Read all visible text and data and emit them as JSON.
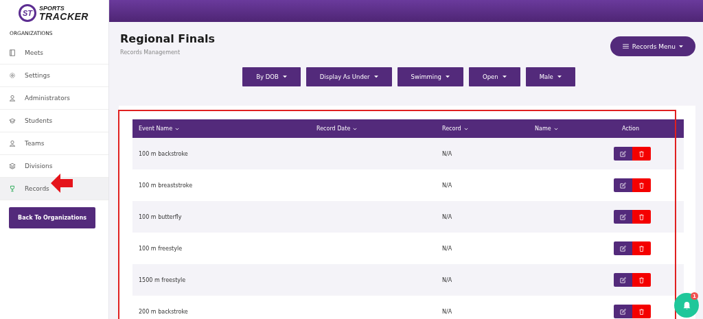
{
  "brand": {
    "mark": "ST",
    "line1": "SPORTS",
    "line2": "TRACKER"
  },
  "sidebar": {
    "heading": "ORGANIZATIONS",
    "items": [
      {
        "label": "Meets",
        "kind": "book",
        "selected": false
      },
      {
        "label": "Settings",
        "kind": "gear",
        "selected": false
      },
      {
        "label": "Administrators",
        "kind": "person",
        "selected": false
      },
      {
        "label": "Students",
        "kind": "cap",
        "selected": false
      },
      {
        "label": "Teams",
        "kind": "person",
        "selected": false
      },
      {
        "label": "Divisions",
        "kind": "layers",
        "selected": false
      },
      {
        "label": "Records",
        "kind": "trophy",
        "selected": true
      }
    ],
    "back_button": "Back To Organizations"
  },
  "header": {
    "title": "Regional Finals",
    "subtitle": "Records Management",
    "menu_button": "Records Menu"
  },
  "filters": [
    "By DOB",
    "Display As Under",
    "Swimming",
    "Open",
    "Male"
  ],
  "table": {
    "columns": [
      "Event Name",
      "Record Date",
      "Record",
      "Name",
      "Action"
    ],
    "rows": [
      {
        "event": "100 m backstroke",
        "record": "N/A"
      },
      {
        "event": "100 m breaststroke",
        "record": "N/A"
      },
      {
        "event": "100 m butterfly",
        "record": "N/A"
      },
      {
        "event": "100 m freestyle",
        "record": "N/A"
      },
      {
        "event": "1500 m freestyle",
        "record": "N/A"
      },
      {
        "event": "200 m backstroke",
        "record": "N/A"
      }
    ]
  },
  "notifications": {
    "count": "1"
  }
}
